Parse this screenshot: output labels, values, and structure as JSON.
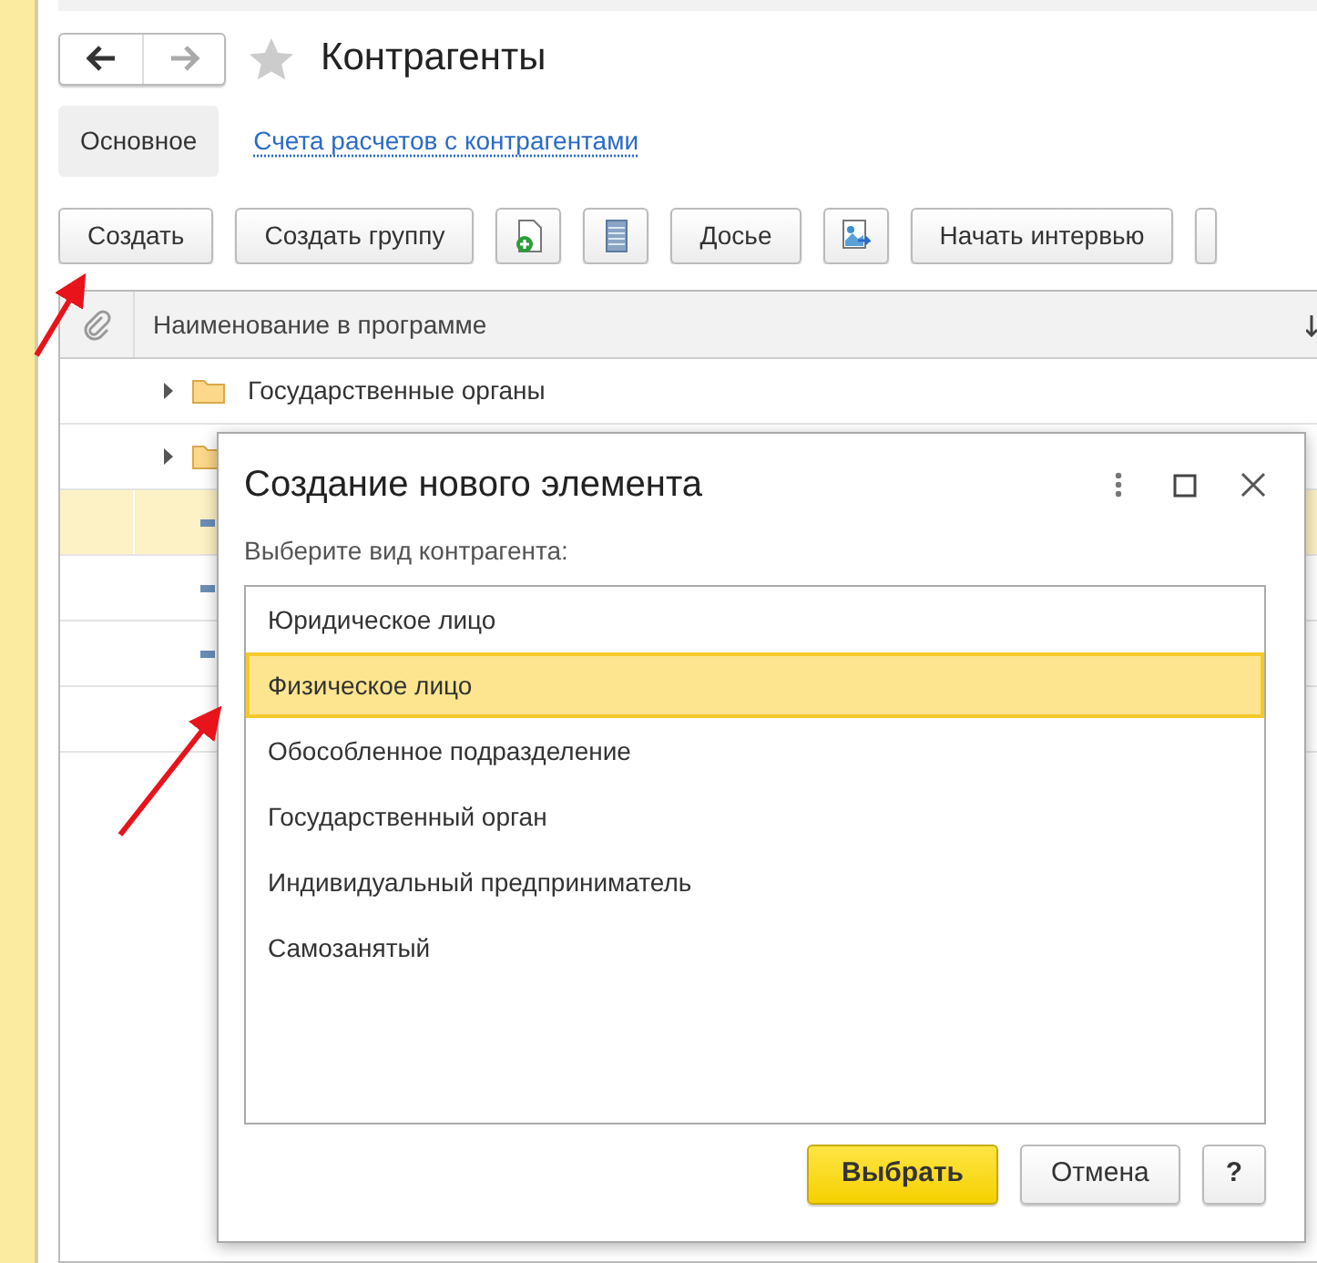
{
  "header": {
    "title": "Контрагенты",
    "favorite": false
  },
  "tabs": [
    {
      "label": "Основное",
      "selected": true
    },
    {
      "label": "Счета расчетов с контрагентами",
      "selected": false
    }
  ],
  "toolbar": [
    {
      "kind": "text",
      "label": "Создать"
    },
    {
      "kind": "text",
      "label": "Создать группу"
    },
    {
      "kind": "add"
    },
    {
      "kind": "list"
    },
    {
      "kind": "text",
      "label": "Досье"
    },
    {
      "kind": "report"
    },
    {
      "kind": "text",
      "label": "Начать интервью"
    },
    {
      "kind": "cut"
    }
  ],
  "table": {
    "columns": [
      "Наименование в программе"
    ],
    "rows": [
      {
        "kind": "folder",
        "name": "Государственные органы",
        "selected": false
      },
      {
        "kind": "folder",
        "selected": false
      },
      {
        "kind": "item",
        "selected": true
      },
      {
        "kind": "item",
        "selected": false
      },
      {
        "kind": "item",
        "selected": false
      }
    ]
  },
  "dialog": {
    "title": "Создание нового элемента",
    "prompt": "Выберите вид контрагента:",
    "items": [
      {
        "label": "Юридическое лицо",
        "selected": false
      },
      {
        "label": "Физическое лицо",
        "selected": true
      },
      {
        "label": "Обособленное подразделение",
        "selected": false
      },
      {
        "label": "Государственный орган",
        "selected": false
      },
      {
        "label": "Индивидуальный предприниматель",
        "selected": false
      },
      {
        "label": "Самозанятый",
        "selected": false
      }
    ],
    "buttons": [
      {
        "kind": "primary",
        "label": "Выбрать"
      },
      {
        "kind": "default",
        "label": "Отмена"
      },
      {
        "kind": "help",
        "label": "?"
      }
    ]
  }
}
